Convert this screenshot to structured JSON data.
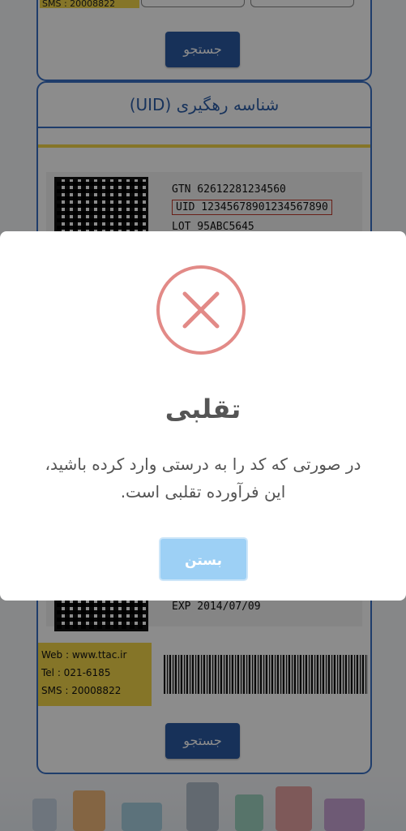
{
  "background": {
    "top_card": {
      "sms_text": "SMS : 20008822",
      "search_label": "جستجو"
    },
    "uid_card": {
      "title": "شناسه رهگیری (UID)",
      "gtin": "GTN 62612281234560",
      "uid": "UID 12345678901234567890",
      "lot": "LOT 95ABC5645",
      "exp": "EXP 2014/07/09",
      "web": "Web : www.ttac.ir",
      "tel": "Tel : 021-6185",
      "sms": "SMS : 20008822",
      "search_label": "جستجو"
    }
  },
  "dialog": {
    "icon": "error-x-icon",
    "title": "تقلبی",
    "message": "در صورتی که کد را به درستی وارد کرده باشید، این فرآورده تقلبی است.",
    "close_label": "بستن"
  },
  "colors": {
    "accent_blue": "#3a6fc4",
    "button_blue": "#2a5aa3",
    "error_red": "#e28a87",
    "close_button": "#9dd0f5",
    "yellow": "#f3d64a"
  }
}
